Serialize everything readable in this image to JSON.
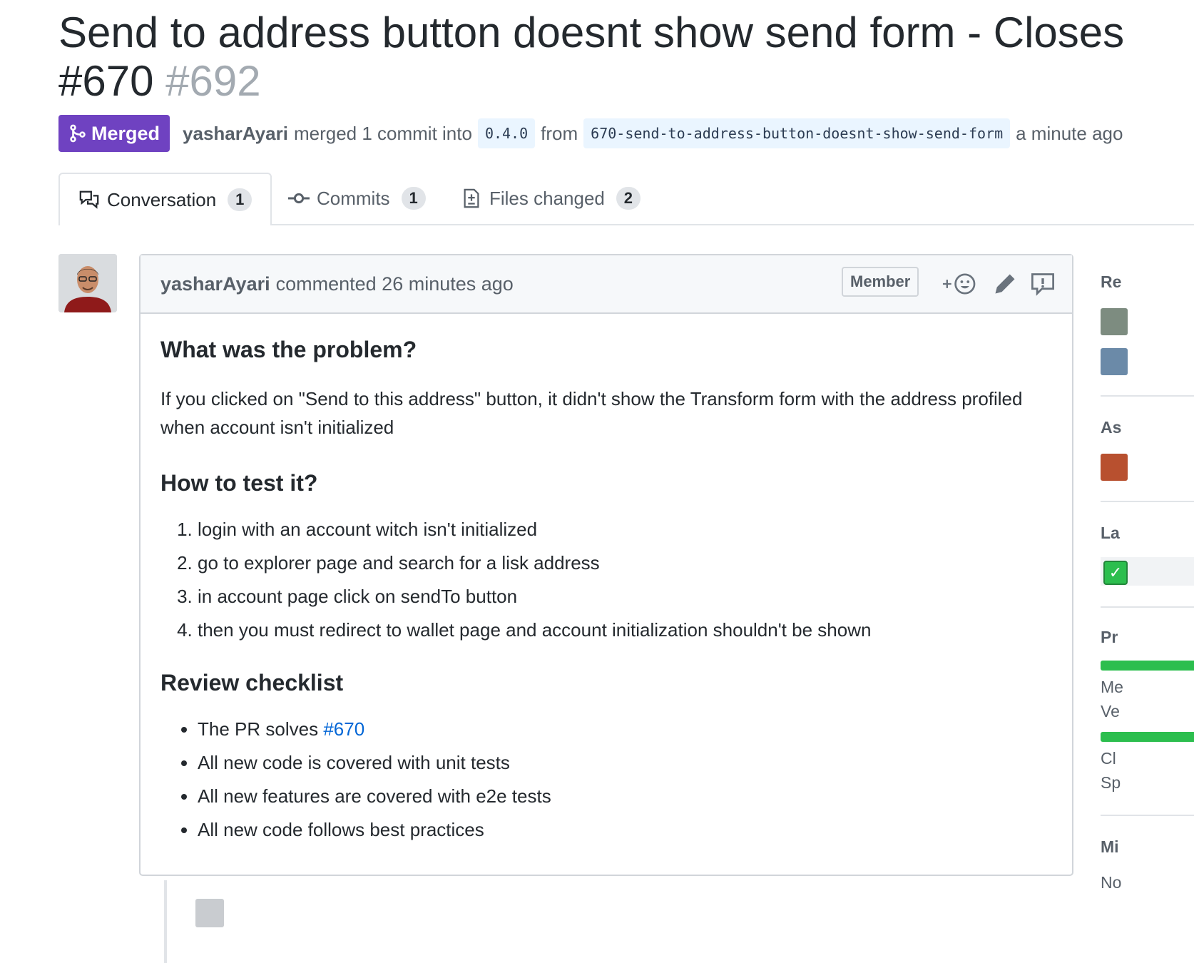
{
  "pr": {
    "title": "Send to address button doesnt show send form - Closes #670",
    "number": "#692",
    "state": "Merged",
    "author": "yasharAyari",
    "merged_text": "merged 1 commit into",
    "base_branch": "0.4.0",
    "from_text": "from",
    "head_branch": "670-send-to-address-button-doesnt-show-send-form",
    "time_text": "a minute ago",
    "state_color": "#6f42c1"
  },
  "tabs": [
    {
      "label": "Conversation",
      "count": "1",
      "icon": "comment-discussion-icon"
    },
    {
      "label": "Commits",
      "count": "1",
      "icon": "git-commit-icon"
    },
    {
      "label": "Files changed",
      "count": "2",
      "icon": "file-diff-icon"
    }
  ],
  "comment": {
    "author": "yasharAyari",
    "action": "commented 26 minutes ago",
    "role": "Member",
    "icons": [
      "add-reaction-icon",
      "pencil-icon",
      "report-icon"
    ],
    "sections": {
      "problem_heading": "What was the problem?",
      "problem_text": "If you clicked on \"Send to this address\" button, it didn't show the Transform form with the address profiled when account isn't initialized",
      "test_heading": "How to test it?",
      "test_steps": [
        "login with an account witch isn't initialized",
        "go to explorer page and search for a lisk address",
        "in account page click on sendTo button",
        "then you must redirect to wallet page and account initialization shouldn't be shown"
      ],
      "checklist_heading": "Review checklist",
      "checklist_solves_prefix": "The PR solves",
      "checklist_solves_link": "#670",
      "checklist_items": [
        "All new code is covered with unit tests",
        "All new features are covered with e2e tests",
        "All new code follows best practices"
      ]
    }
  },
  "sidebar": {
    "reviewers_heading": "Re",
    "assignees_heading": "As",
    "labels_heading": "La",
    "projects_heading": "Pr",
    "project1_line1": "Me",
    "project1_line2": "Ve",
    "project2_line1": "Cl",
    "project2_line2": "Sp",
    "milestone_heading": "Mi",
    "milestone_text": "No",
    "label_icon": "check-mark-icon",
    "accent_green": "#2cbe4e"
  }
}
